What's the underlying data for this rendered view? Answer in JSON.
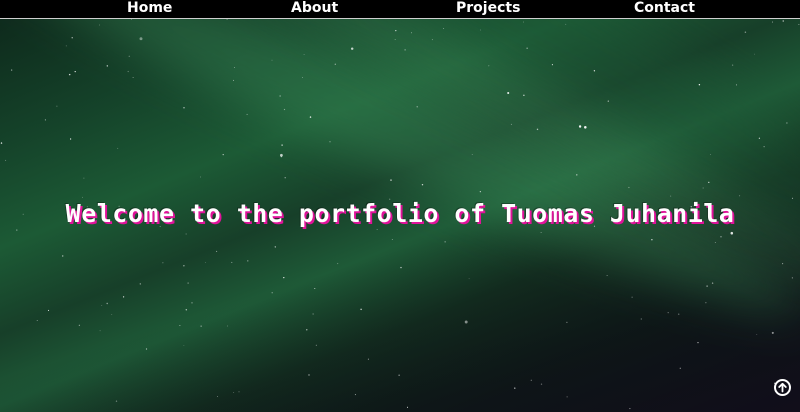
{
  "nav": {
    "home": "Home",
    "about": "About",
    "projects": "Projects",
    "contact": "Contact"
  },
  "hero": {
    "title": "Welcome to the portfolio of Tuomas Juhanila"
  },
  "icons": {
    "scroll_top": "arrow-up-circle-icon"
  },
  "colors": {
    "nav_background": "#000000",
    "nav_text": "#ffffff",
    "title_text": "#ffffff",
    "title_shadow": "#e0129a",
    "aurora_green": "#1c5a35"
  }
}
